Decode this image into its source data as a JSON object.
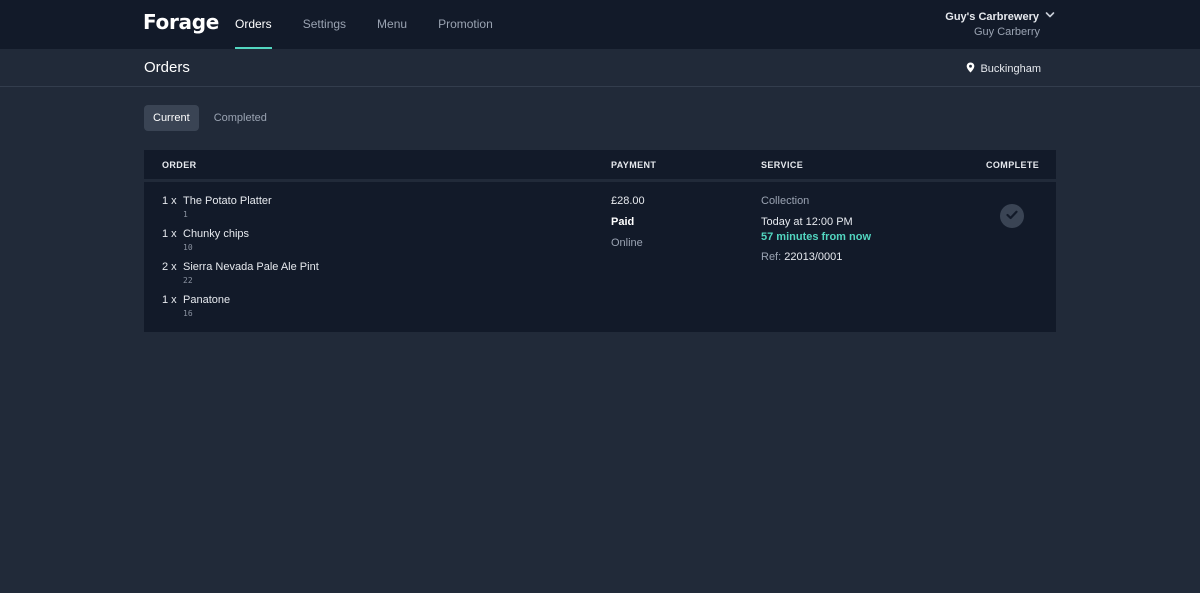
{
  "app": {
    "logo": "Forage"
  },
  "nav": [
    {
      "label": "Orders"
    },
    {
      "label": "Settings"
    },
    {
      "label": "Menu"
    },
    {
      "label": "Promotion"
    }
  ],
  "account": {
    "venue": "Guy's Carbrewery",
    "user": "Guy Carberry"
  },
  "page": {
    "title": "Orders",
    "location": "Buckingham"
  },
  "tabs": [
    {
      "label": "Current"
    },
    {
      "label": "Completed"
    }
  ],
  "table": {
    "headers": {
      "order": "ORDER",
      "payment": "PAYMENT",
      "service": "SERVICE",
      "complete": "COMPLETE"
    },
    "order": {
      "items": [
        {
          "qty": "1 x",
          "name": "The Potato Platter",
          "code": "1"
        },
        {
          "qty": "1 x",
          "name": "Chunky chips",
          "code": "10"
        },
        {
          "qty": "2 x",
          "name": "Sierra Nevada Pale Ale Pint",
          "code": "22"
        },
        {
          "qty": "1 x",
          "name": "Panatone",
          "code": "16"
        }
      ],
      "payment": {
        "amount": "£28.00",
        "status": "Paid",
        "method": "Online"
      },
      "service": {
        "type": "Collection",
        "time": "Today at 12:00 PM",
        "relative": "57 minutes from now",
        "ref_label": "Ref:",
        "ref_value": "22013/0001"
      }
    }
  },
  "colors": {
    "accent": "#52d6c0",
    "topbar": "#121a29",
    "background": "#212a39"
  }
}
